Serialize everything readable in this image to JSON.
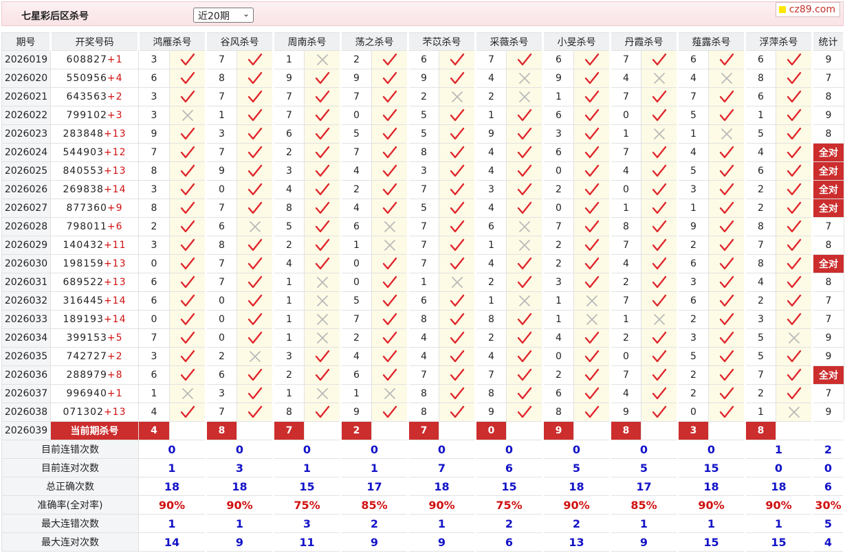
{
  "header": {
    "title": "七星彩后区杀号",
    "select_value": "近20期",
    "brand": "cz89.com"
  },
  "columns": {
    "period": "期号",
    "draw": "开奖号码",
    "experts": [
      "鸿雁杀号",
      "谷风杀号",
      "周南杀号",
      "荡之杀号",
      "芣苡杀号",
      "采薇杀号",
      "小旻杀号",
      "丹霞杀号",
      "薤露杀号",
      "浮萍杀号"
    ],
    "stat": "统计"
  },
  "rows": [
    {
      "period": "2026019",
      "draw": "608827",
      "extra": "+1",
      "kills": [
        3,
        7,
        1,
        2,
        6,
        7,
        6,
        7,
        6,
        6
      ],
      "hits": [
        1,
        1,
        0,
        1,
        1,
        1,
        1,
        1,
        1,
        1
      ],
      "stat": "9"
    },
    {
      "period": "2026020",
      "draw": "550956",
      "extra": "+4",
      "kills": [
        6,
        8,
        9,
        9,
        9,
        4,
        9,
        4,
        4,
        8
      ],
      "hits": [
        1,
        1,
        1,
        1,
        1,
        0,
        1,
        0,
        0,
        1
      ],
      "stat": "7"
    },
    {
      "period": "2026021",
      "draw": "643563",
      "extra": "+2",
      "kills": [
        3,
        7,
        7,
        7,
        2,
        2,
        1,
        7,
        7,
        6
      ],
      "hits": [
        1,
        1,
        1,
        1,
        0,
        0,
        1,
        1,
        1,
        1
      ],
      "stat": "8"
    },
    {
      "period": "2026022",
      "draw": "799102",
      "extra": "+3",
      "kills": [
        3,
        1,
        7,
        0,
        5,
        1,
        6,
        0,
        5,
        1
      ],
      "hits": [
        0,
        1,
        1,
        1,
        1,
        1,
        1,
        1,
        1,
        1
      ],
      "stat": "9"
    },
    {
      "period": "2026023",
      "draw": "283848",
      "extra": "+13",
      "kills": [
        9,
        3,
        6,
        5,
        5,
        9,
        3,
        1,
        1,
        5
      ],
      "hits": [
        1,
        1,
        1,
        1,
        1,
        1,
        1,
        0,
        0,
        1
      ],
      "stat": "8"
    },
    {
      "period": "2026024",
      "draw": "544903",
      "extra": "+12",
      "kills": [
        7,
        7,
        2,
        7,
        8,
        4,
        6,
        7,
        4,
        4
      ],
      "hits": [
        1,
        1,
        1,
        1,
        1,
        1,
        1,
        1,
        1,
        1
      ],
      "stat": "全对"
    },
    {
      "period": "2026025",
      "draw": "840553",
      "extra": "+13",
      "kills": [
        8,
        9,
        3,
        4,
        3,
        4,
        0,
        4,
        5,
        6
      ],
      "hits": [
        1,
        1,
        1,
        1,
        1,
        1,
        1,
        1,
        1,
        1
      ],
      "stat": "全对"
    },
    {
      "period": "2026026",
      "draw": "269838",
      "extra": "+14",
      "kills": [
        3,
        0,
        4,
        2,
        7,
        3,
        2,
        0,
        3,
        2
      ],
      "hits": [
        1,
        1,
        1,
        1,
        1,
        1,
        1,
        1,
        1,
        1
      ],
      "stat": "全对"
    },
    {
      "period": "2026027",
      "draw": "877360",
      "extra": "+9",
      "kills": [
        8,
        7,
        8,
        4,
        5,
        4,
        0,
        1,
        1,
        2
      ],
      "hits": [
        1,
        1,
        1,
        1,
        1,
        1,
        1,
        1,
        1,
        1
      ],
      "stat": "全对"
    },
    {
      "period": "2026028",
      "draw": "798011",
      "extra": "+6",
      "kills": [
        2,
        6,
        5,
        6,
        7,
        6,
        7,
        8,
        9,
        8
      ],
      "hits": [
        1,
        0,
        1,
        0,
        1,
        0,
        1,
        1,
        1,
        1
      ],
      "stat": "7"
    },
    {
      "period": "2026029",
      "draw": "140432",
      "extra": "+11",
      "kills": [
        3,
        8,
        2,
        1,
        7,
        1,
        2,
        7,
        2,
        7
      ],
      "hits": [
        1,
        1,
        1,
        0,
        1,
        0,
        1,
        1,
        1,
        1
      ],
      "stat": "8"
    },
    {
      "period": "2026030",
      "draw": "198159",
      "extra": "+13",
      "kills": [
        0,
        7,
        4,
        0,
        7,
        4,
        2,
        4,
        6,
        8
      ],
      "hits": [
        1,
        1,
        1,
        1,
        1,
        1,
        1,
        1,
        1,
        1
      ],
      "stat": "全对"
    },
    {
      "period": "2026031",
      "draw": "689522",
      "extra": "+13",
      "kills": [
        6,
        7,
        1,
        0,
        1,
        2,
        3,
        2,
        3,
        4
      ],
      "hits": [
        1,
        1,
        0,
        1,
        0,
        1,
        1,
        1,
        1,
        1
      ],
      "stat": "8"
    },
    {
      "period": "2026032",
      "draw": "316445",
      "extra": "+14",
      "kills": [
        6,
        0,
        1,
        5,
        6,
        1,
        1,
        7,
        6,
        2
      ],
      "hits": [
        1,
        1,
        0,
        1,
        1,
        0,
        0,
        1,
        1,
        1
      ],
      "stat": "7"
    },
    {
      "period": "2026033",
      "draw": "189193",
      "extra": "+14",
      "kills": [
        0,
        0,
        1,
        7,
        8,
        8,
        1,
        1,
        2,
        3
      ],
      "hits": [
        1,
        1,
        0,
        1,
        1,
        1,
        0,
        0,
        1,
        1
      ],
      "stat": "7"
    },
    {
      "period": "2026034",
      "draw": "399153",
      "extra": "+5",
      "kills": [
        7,
        0,
        1,
        2,
        4,
        2,
        4,
        2,
        3,
        5
      ],
      "hits": [
        1,
        1,
        0,
        1,
        1,
        1,
        1,
        1,
        1,
        0
      ],
      "stat": "9"
    },
    {
      "period": "2026035",
      "draw": "742727",
      "extra": "+2",
      "kills": [
        3,
        2,
        3,
        4,
        4,
        4,
        0,
        0,
        5,
        5
      ],
      "hits": [
        1,
        0,
        1,
        1,
        1,
        1,
        1,
        1,
        1,
        1
      ],
      "stat": "9"
    },
    {
      "period": "2026036",
      "draw": "288979",
      "extra": "+8",
      "kills": [
        6,
        6,
        2,
        6,
        7,
        7,
        2,
        7,
        2,
        7
      ],
      "hits": [
        1,
        1,
        1,
        1,
        1,
        1,
        1,
        1,
        1,
        1
      ],
      "stat": "全对"
    },
    {
      "period": "2026037",
      "draw": "996940",
      "extra": "+1",
      "kills": [
        1,
        3,
        1,
        1,
        8,
        8,
        6,
        4,
        2,
        2
      ],
      "hits": [
        0,
        1,
        0,
        0,
        1,
        1,
        1,
        1,
        1,
        1
      ],
      "stat": "7"
    },
    {
      "period": "2026038",
      "draw": "071302",
      "extra": "+13",
      "kills": [
        4,
        7,
        8,
        9,
        8,
        9,
        8,
        9,
        0,
        1
      ],
      "hits": [
        1,
        1,
        1,
        1,
        1,
        1,
        1,
        1,
        1,
        0
      ],
      "stat": "9"
    }
  ],
  "current": {
    "period": "2026039",
    "label": "当前期杀号",
    "kills": [
      "4",
      "8",
      "7",
      "2",
      "7",
      "0",
      "9",
      "8",
      "3",
      "8"
    ]
  },
  "summary": [
    {
      "label": "目前连错次数",
      "values": [
        "0",
        "0",
        "0",
        "0",
        "0",
        "0",
        "0",
        "0",
        "0",
        "1"
      ],
      "stat": "2",
      "red": false
    },
    {
      "label": "目前连对次数",
      "values": [
        "1",
        "3",
        "1",
        "1",
        "7",
        "6",
        "5",
        "5",
        "15",
        "0"
      ],
      "stat": "0",
      "red": false
    },
    {
      "label": "总正确次数",
      "values": [
        "18",
        "18",
        "15",
        "17",
        "18",
        "15",
        "18",
        "17",
        "18",
        "18"
      ],
      "stat": "6",
      "red": false
    },
    {
      "label": "准确率(全对率)",
      "values": [
        "90%",
        "90%",
        "75%",
        "85%",
        "90%",
        "75%",
        "90%",
        "85%",
        "90%",
        "90%"
      ],
      "stat": "30%",
      "red": true
    },
    {
      "label": "最大连错次数",
      "values": [
        "1",
        "1",
        "3",
        "2",
        "1",
        "2",
        "2",
        "1",
        "1",
        "1"
      ],
      "stat": "5",
      "red": false
    },
    {
      "label": "最大连对次数",
      "values": [
        "14",
        "9",
        "11",
        "9",
        "9",
        "6",
        "13",
        "9",
        "15",
        "15"
      ],
      "stat": "4",
      "red": false
    }
  ],
  "icons": {
    "hit": "check-icon",
    "miss": "cross-icon"
  },
  "colors": {
    "hit": "#e0262c",
    "miss": "#b9b9b9",
    "accent": "#cc2d2d",
    "blue": "#1313c8"
  }
}
